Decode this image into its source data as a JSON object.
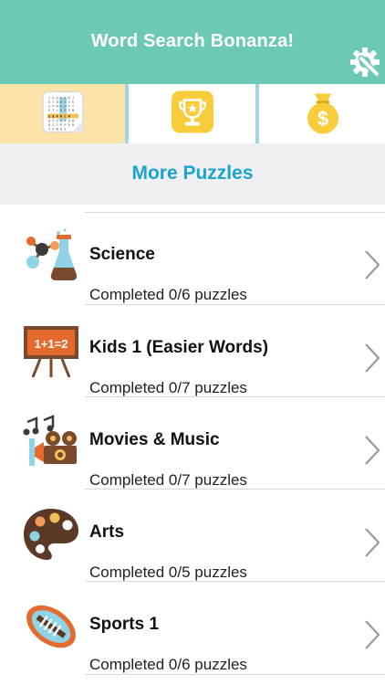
{
  "header": {
    "title": "Word Search Bonanza!",
    "settings_icon": "gear-wrench-icon",
    "bg_color": "#6cc9b5"
  },
  "tabs": [
    {
      "name": "puzzles",
      "icon": "word-search-grid-icon",
      "selected": true,
      "grid_text": [
        "IEDEKMJ",
        "ETBWSXK",
        "SPMVHPY",
        "XTLQSGN",
        "SEARCH",
        "QTGRJOB",
        "BSIPPDH",
        "TONRJ"
      ],
      "grid_highlight": "SEARCH"
    },
    {
      "name": "achievements",
      "icon": "trophy-icon",
      "selected": false
    },
    {
      "name": "store",
      "icon": "money-bag-icon",
      "selected": false
    }
  ],
  "section": {
    "title": "More Puzzles",
    "title_color": "#1aa3cd"
  },
  "categories": [
    {
      "title": "Science",
      "subtitle": "Completed 0/6 puzzles",
      "icon": "science-flask-icon"
    },
    {
      "title": "Kids 1 (Easier Words)",
      "subtitle": "Completed 0/7 puzzles",
      "icon": "chalkboard-icon",
      "icon_text": "1+1=2"
    },
    {
      "title": "Movies & Music",
      "subtitle": "Completed 0/7 puzzles",
      "icon": "film-projector-music-icon"
    },
    {
      "title": "Arts",
      "subtitle": "Completed 0/5 puzzles",
      "icon": "paint-palette-icon"
    },
    {
      "title": "Sports 1",
      "subtitle": "Completed 0/6 puzzles",
      "icon": "football-icon"
    }
  ]
}
